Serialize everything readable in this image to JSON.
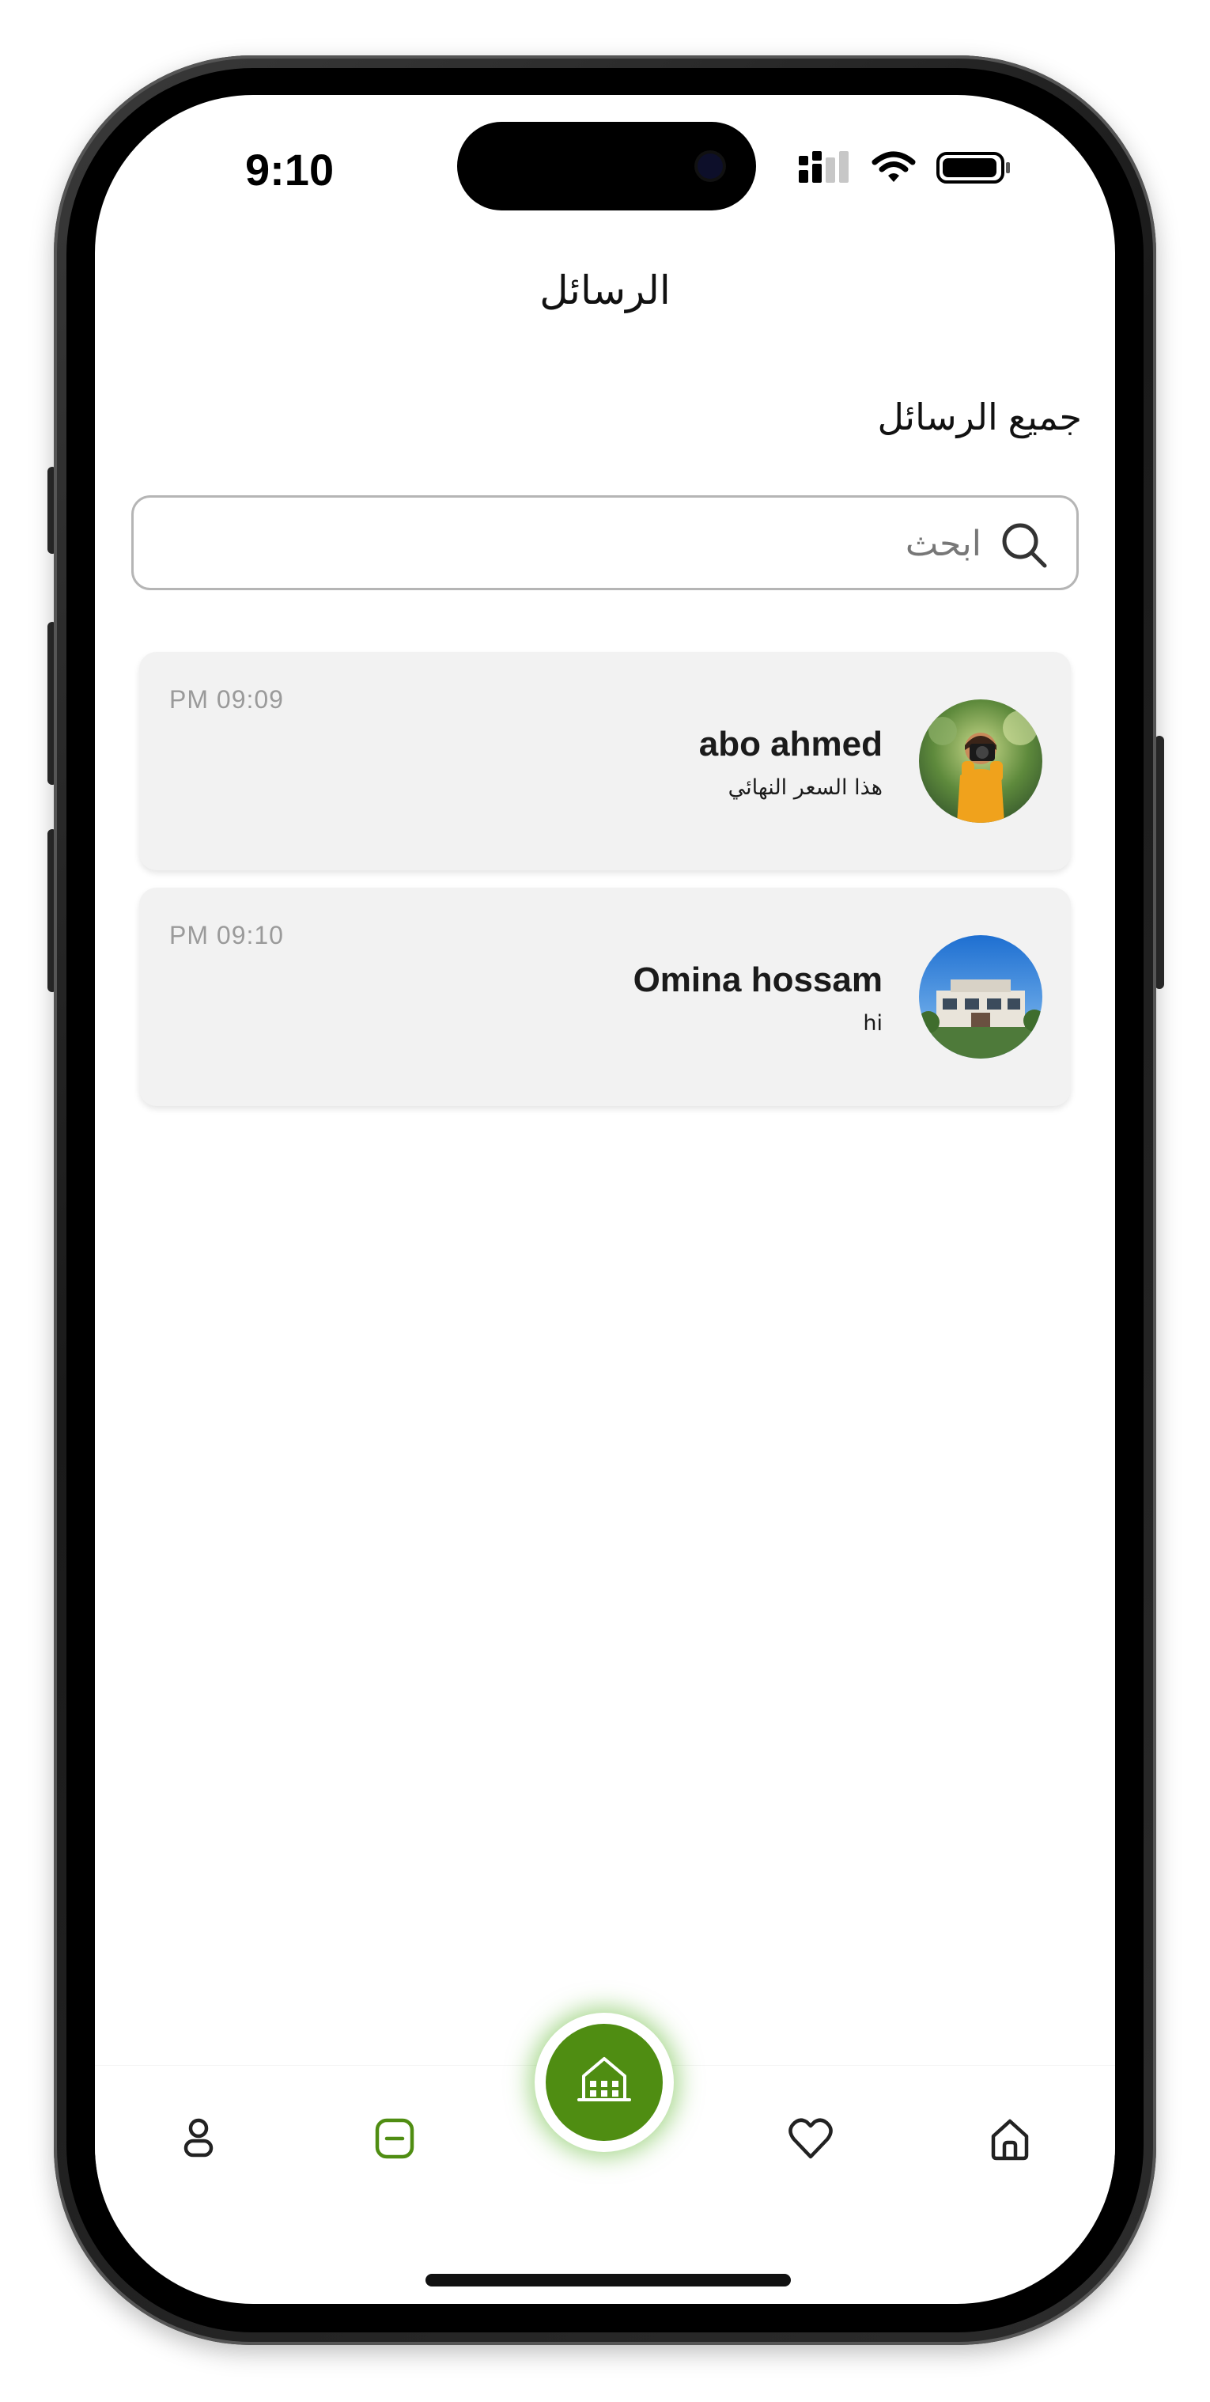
{
  "status_bar": {
    "time": "9:10"
  },
  "header": {
    "title": "الرسائل"
  },
  "section": {
    "title": "جميع الرسائل"
  },
  "search": {
    "placeholder": "ابحث",
    "value": ""
  },
  "chats": [
    {
      "time": "PM 09:09",
      "name": "abo ahmed",
      "preview": "هذا السعر النهائي",
      "avatar_icon": "person-photographer-avatar"
    },
    {
      "time": "PM 09:10",
      "name": "Omina hossam",
      "preview": "hi",
      "avatar_icon": "house-photo-avatar"
    }
  ],
  "bottom_nav": {
    "active": "messages",
    "items": [
      {
        "icon": "profile-icon"
      },
      {
        "icon": "messages-icon"
      },
      {
        "icon": "add-property-icon"
      },
      {
        "icon": "favorites-icon"
      },
      {
        "icon": "home-icon"
      }
    ]
  },
  "colors": {
    "accent": "#4f8d12",
    "card_bg": "#f2f2f2",
    "time_text": "#9a9a9a"
  }
}
